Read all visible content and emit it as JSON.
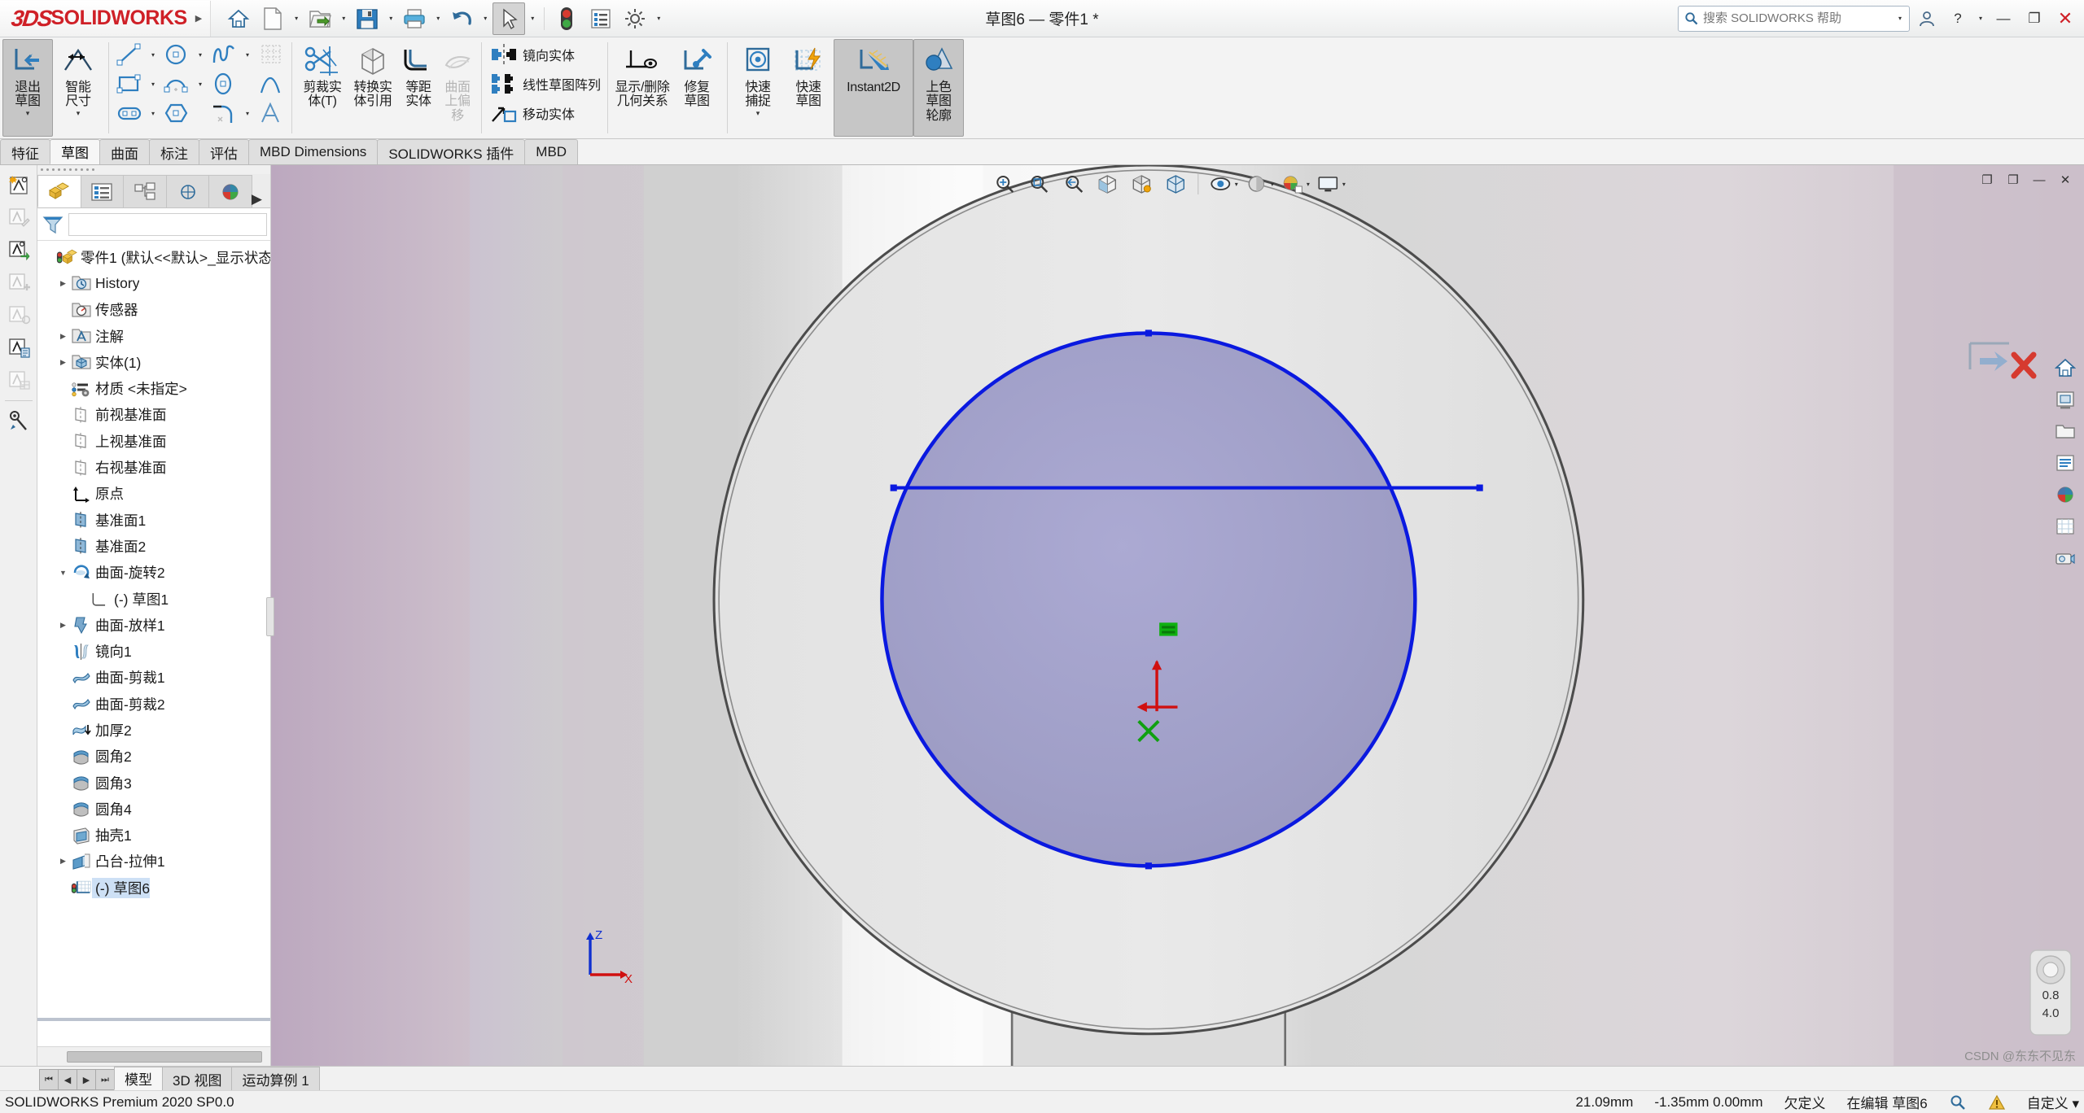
{
  "window": {
    "document_title": "草图6 — 零件1 *",
    "help_search_placeholder": "搜索 SOLIDWORKS 帮助",
    "minimize": "—",
    "restore": "❐",
    "close": "✕",
    "help": "?",
    "help_caret": "▾",
    "user_icon": "user-icon"
  },
  "brand": {
    "three_ds": "3DS",
    "solid": "SOLID",
    "works": "WORKS",
    "expander": "▶"
  },
  "quick_access": [
    {
      "name": "home-button",
      "icon": "home-icon",
      "dropdown": false
    },
    {
      "name": "new-document-button",
      "icon": "new-doc-icon",
      "dropdown": true
    },
    {
      "name": "open-document-button",
      "icon": "open-folder-icon",
      "dropdown": true
    },
    {
      "name": "save-button",
      "icon": "floppy-save-icon",
      "dropdown": true
    },
    {
      "name": "print-button",
      "icon": "printer-icon",
      "dropdown": true
    },
    {
      "name": "undo-button",
      "icon": "undo-arrow-icon",
      "dropdown": true
    },
    {
      "name": "select-button",
      "icon": "cursor-arrow-icon",
      "dropdown": true,
      "selected": true
    },
    {
      "name": "rebuild-button",
      "icon": "traffic-light-icon",
      "dropdown": false
    },
    {
      "name": "options-list-button",
      "icon": "list-panel-icon",
      "dropdown": false
    },
    {
      "name": "settings-button",
      "icon": "gear-icon",
      "dropdown": true
    }
  ],
  "ribbon": {
    "groups": [
      {
        "name": "sketch-exit-group",
        "buttons": [
          {
            "name": "exit-sketch-button",
            "label": "退出\n草图",
            "icon": "exit-sketch-icon",
            "active": true,
            "dropdown": true
          },
          {
            "name": "smart-dimension-button",
            "label": "智能\n尺寸",
            "icon": "smart-dimension-icon",
            "dropdown": true
          }
        ]
      },
      {
        "name": "sketch-entities-group",
        "rows": [
          [
            {
              "name": "line-tool",
              "icon": "line-icon",
              "dd": true
            },
            {
              "name": "circle-tool",
              "icon": "circle-icon",
              "dd": true
            },
            {
              "name": "spline-tool",
              "icon": "spline-icon",
              "dd": true
            },
            {
              "name": "grid-tool",
              "icon": "grid-icon",
              "dd": false,
              "disabled": true
            }
          ],
          [
            {
              "name": "rectangle-tool",
              "icon": "rectangle-icon",
              "dd": true
            },
            {
              "name": "arc-tool",
              "icon": "arc-icon",
              "dd": true
            },
            {
              "name": "ellipse-tool",
              "icon": "ellipse-icon",
              "dd": false
            },
            {
              "name": "parabola-tool",
              "icon": "parabola-icon",
              "dd": false
            }
          ],
          [
            {
              "name": "slot-tool",
              "icon": "slot-icon",
              "dd": true
            },
            {
              "name": "polygon-tool",
              "icon": "polygon-icon",
              "dd": false
            },
            {
              "name": "fillet-tool",
              "icon": "sketch-fillet-icon",
              "dd": true
            },
            {
              "name": "text-tool",
              "icon": "text-A-icon",
              "dd": false
            }
          ]
        ]
      },
      {
        "name": "sketch-edit-group",
        "buttons": [
          {
            "name": "trim-entities-button",
            "label": "剪裁实\n体(T)",
            "icon": "scissors-icon"
          },
          {
            "name": "convert-entities-button",
            "label": "转换实\n体引用",
            "icon": "cube-convert-icon"
          },
          {
            "name": "offset-entities-button",
            "label": "等距\n实体",
            "icon": "offset-icon"
          },
          {
            "name": "offset-on-surface-button",
            "label": "曲面\n上偏\n移",
            "icon": "surface-offset-icon",
            "disabled": true
          }
        ]
      },
      {
        "name": "pattern-group",
        "text_buttons": [
          {
            "name": "mirror-entities-button",
            "label": "镜向实体",
            "icon": "mirror-icon"
          },
          {
            "name": "linear-sketch-pattern-button",
            "label": "线性草图阵列",
            "icon": "linear-pattern-icon"
          },
          {
            "name": "move-entities-button",
            "label": "移动实体",
            "icon": "move-entities-icon"
          }
        ]
      },
      {
        "name": "relations-group",
        "buttons": [
          {
            "name": "display-delete-relations-button",
            "label": "显示/删除\n几何关系",
            "icon": "relations-eye-icon",
            "wide": true
          },
          {
            "name": "repair-sketch-button",
            "label": "修复\n草图",
            "icon": "repair-wrench-icon"
          }
        ]
      },
      {
        "name": "tools-group",
        "buttons": [
          {
            "name": "quick-snaps-button",
            "label": "快速\n捕捉",
            "icon": "quick-snap-icon",
            "dropdown": true
          },
          {
            "name": "rapid-sketch-button",
            "label": "快速\n草图",
            "icon": "rapid-sketch-icon"
          },
          {
            "name": "instant2d-button",
            "label": "Instant2D",
            "icon": "instant2d-icon",
            "active": true,
            "wide": true
          },
          {
            "name": "shaded-sketch-contours-button",
            "label": "上色\n草图\n轮廓",
            "icon": "shaded-contour-icon",
            "active": true
          }
        ]
      }
    ],
    "tabs": [
      {
        "name": "tab-features",
        "label": "特征",
        "active": false
      },
      {
        "name": "tab-sketch",
        "label": "草图",
        "active": true
      },
      {
        "name": "tab-surfaces",
        "label": "曲面",
        "active": false
      },
      {
        "name": "tab-annotations",
        "label": "标注",
        "active": false
      },
      {
        "name": "tab-evaluate",
        "label": "评估",
        "active": false
      },
      {
        "name": "tab-mbd-dimensions",
        "label": "MBD Dimensions",
        "active": false
      },
      {
        "name": "tab-sw-addins",
        "label": "SOLIDWORKS 插件",
        "active": false
      },
      {
        "name": "tab-mbd",
        "label": "MBD",
        "active": false
      }
    ]
  },
  "left_rail": [
    {
      "name": "rail-annotation-new-icon",
      "icon": "A-star-icon"
    },
    {
      "name": "rail-annotation-edit-icon",
      "icon": "A-pencil-icon",
      "disabled": true
    },
    {
      "name": "rail-annotation-move-icon",
      "icon": "A-green-arrow-icon"
    },
    {
      "name": "rail-annotation-add-icon",
      "icon": "A-plus-icon",
      "disabled": true
    },
    {
      "name": "rail-annotation-balloon-icon",
      "icon": "A-balloon-icon",
      "disabled": true
    },
    {
      "name": "rail-annotation-note-icon",
      "icon": "A-note-icon"
    },
    {
      "name": "rail-annotation-table-icon",
      "icon": "A-table-icon",
      "disabled": true
    },
    {
      "name": "rail-measure-icon",
      "icon": "measure-icon"
    }
  ],
  "feature_manager": {
    "tabs": [
      {
        "name": "fm-tab-featuretree",
        "icon": "feature-tree-icon",
        "active": true
      },
      {
        "name": "fm-tab-propertymanager",
        "icon": "property-manager-icon",
        "active": false
      },
      {
        "name": "fm-tab-configurationmanager",
        "icon": "configuration-icon",
        "active": false
      },
      {
        "name": "fm-tab-dimxpert",
        "icon": "dimxpert-icon",
        "active": false
      },
      {
        "name": "fm-tab-appearances",
        "icon": "appearances-sphere-icon",
        "active": false
      }
    ],
    "tabs_overflow": "▶",
    "filter": {
      "name": "tree-filter-input",
      "placeholder": "",
      "icon": "funnel-icon"
    },
    "tree": [
      {
        "name": "tree-item-part1",
        "label": "零件1  (默认<<默认>_显示状态",
        "icon": "part-icon",
        "indent": 0,
        "arrow": "",
        "warn": true,
        "root": true
      },
      {
        "name": "tree-item-history",
        "label": "History",
        "icon": "history-folder-icon",
        "indent": 1,
        "arrow": "▶"
      },
      {
        "name": "tree-item-sensors",
        "label": "传感器",
        "icon": "sensor-folder-icon",
        "indent": 1,
        "arrow": ""
      },
      {
        "name": "tree-item-annotations",
        "label": "注解",
        "icon": "annotation-folder-icon",
        "indent": 1,
        "arrow": "▶"
      },
      {
        "name": "tree-item-solid-bodies",
        "label": "实体(1)",
        "icon": "solid-bodies-folder-icon",
        "indent": 1,
        "arrow": "▶"
      },
      {
        "name": "tree-item-material",
        "label": "材质 <未指定>",
        "icon": "material-icon",
        "indent": 1,
        "arrow": ""
      },
      {
        "name": "tree-item-front-plane",
        "label": "前视基准面",
        "icon": "plane-gray-icon",
        "indent": 1,
        "arrow": ""
      },
      {
        "name": "tree-item-top-plane",
        "label": "上视基准面",
        "icon": "plane-gray-icon",
        "indent": 1,
        "arrow": ""
      },
      {
        "name": "tree-item-right-plane",
        "label": "右视基准面",
        "icon": "plane-gray-icon",
        "indent": 1,
        "arrow": ""
      },
      {
        "name": "tree-item-origin",
        "label": "原点",
        "icon": "origin-icon",
        "indent": 1,
        "arrow": ""
      },
      {
        "name": "tree-item-plane1",
        "label": "基准面1",
        "icon": "plane-blue-icon",
        "indent": 1,
        "arrow": ""
      },
      {
        "name": "tree-item-plane2",
        "label": "基准面2",
        "icon": "plane-blue-icon",
        "indent": 1,
        "arrow": ""
      },
      {
        "name": "tree-item-surface-revolve2",
        "label": "曲面-旋转2",
        "icon": "surface-revolve-icon",
        "indent": 1,
        "arrow": "▼"
      },
      {
        "name": "tree-item-sketch1",
        "label": "(-) 草图1",
        "icon": "sketch-icon",
        "indent": 2,
        "arrow": ""
      },
      {
        "name": "tree-item-surface-loft1",
        "label": "曲面-放样1",
        "icon": "surface-loft-icon",
        "indent": 1,
        "arrow": "▶"
      },
      {
        "name": "tree-item-mirror1",
        "label": "镜向1",
        "icon": "mirror-feature-icon",
        "indent": 1,
        "arrow": ""
      },
      {
        "name": "tree-item-surface-trim1",
        "label": "曲面-剪裁1",
        "icon": "surface-trim-icon",
        "indent": 1,
        "arrow": ""
      },
      {
        "name": "tree-item-surface-trim2",
        "label": "曲面-剪裁2",
        "icon": "surface-trim-icon",
        "indent": 1,
        "arrow": ""
      },
      {
        "name": "tree-item-thicken2",
        "label": "加厚2",
        "icon": "thicken-icon",
        "indent": 1,
        "arrow": ""
      },
      {
        "name": "tree-item-fillet2",
        "label": "圆角2",
        "icon": "fillet-icon",
        "indent": 1,
        "arrow": ""
      },
      {
        "name": "tree-item-fillet3",
        "label": "圆角3",
        "icon": "fillet-icon",
        "indent": 1,
        "arrow": ""
      },
      {
        "name": "tree-item-fillet4",
        "label": "圆角4",
        "icon": "fillet-icon",
        "indent": 1,
        "arrow": ""
      },
      {
        "name": "tree-item-shell1",
        "label": "抽壳1",
        "icon": "shell-icon",
        "indent": 1,
        "arrow": ""
      },
      {
        "name": "tree-item-boss-extrude1",
        "label": "凸台-拉伸1",
        "icon": "boss-extrude-icon",
        "indent": 1,
        "arrow": "▶"
      },
      {
        "name": "tree-item-sketch6",
        "label": "(-) 草图6",
        "icon": "sketch-active-icon",
        "indent": 1,
        "arrow": "",
        "warn": true,
        "selected": true
      }
    ]
  },
  "view_toolbar": [
    {
      "name": "zoom-to-fit-button",
      "icon": "zoom-fit-icon"
    },
    {
      "name": "zoom-to-area-button",
      "icon": "zoom-area-icon"
    },
    {
      "name": "previous-view-button",
      "icon": "previous-view-icon"
    },
    {
      "name": "section-view-button",
      "icon": "section-view-icon"
    },
    {
      "name": "view-orientation-button",
      "icon": "view-orientation-icon"
    },
    {
      "name": "display-style-button",
      "icon": "display-style-icon"
    },
    {
      "name": "hide-show-items-button",
      "icon": "hide-show-eye-icon",
      "dropdown": true
    },
    {
      "name": "edit-appearance-button",
      "icon": "edit-appearance-icon",
      "dropdown": true
    },
    {
      "name": "apply-scene-button",
      "icon": "apply-scene-icon",
      "dropdown": true
    },
    {
      "name": "view-settings-button",
      "icon": "view-settings-icon",
      "dropdown": true
    },
    {
      "name": "viewport-button",
      "icon": "viewport-icon",
      "dropdown": true
    }
  ],
  "graphics_window_controls": {
    "restore_down": "❐",
    "maximize": "❐",
    "minimize": "—",
    "close": "✕"
  },
  "right_tools": [
    {
      "name": "home-view-icon",
      "icon": "house-icon"
    },
    {
      "name": "print3d-icon",
      "icon": "printer-3d-icon"
    },
    {
      "name": "new-folder-icon",
      "icon": "folder-icon"
    },
    {
      "name": "detail-list-icon",
      "icon": "list-icon"
    },
    {
      "name": "appearance-sphere-icon",
      "icon": "sphere-icon"
    },
    {
      "name": "scene-grid-icon",
      "icon": "grid-scene-icon"
    },
    {
      "name": "camera-icon",
      "icon": "camera-icon"
    }
  ],
  "confirm_corner": {
    "ok_icon": "blue-check-arrow-icon",
    "cancel_icon": "red-x-icon"
  },
  "triad": {
    "z": "Z",
    "x": "X"
  },
  "sketch": {
    "equal_relation_marker": "=",
    "origin_marker": "origin-axes"
  },
  "magnifier": {
    "zoom_high": "0.8",
    "zoom_low": "4.0"
  },
  "watermark": "CSDN @东东不见东",
  "bottom": {
    "nav": [
      "⏮",
      "◀",
      "▶",
      "⏭"
    ],
    "tabs": [
      {
        "name": "bottom-tab-model",
        "label": "模型",
        "active": true
      },
      {
        "name": "bottom-tab-3dview",
        "label": "3D 视图",
        "active": false
      },
      {
        "name": "bottom-tab-motionstudy1",
        "label": "运动算例 1",
        "active": false
      }
    ]
  },
  "status": {
    "product": "SOLIDWORKS Premium 2020 SP0.0",
    "length": "21.09mm",
    "coords": "-1.35mm  0.00mm",
    "state": "欠定义",
    "editing": "在编辑 草图6",
    "icons": [
      "magnifier-status-icon",
      "warning-status-icon"
    ],
    "custom": "自定义 ▾"
  }
}
